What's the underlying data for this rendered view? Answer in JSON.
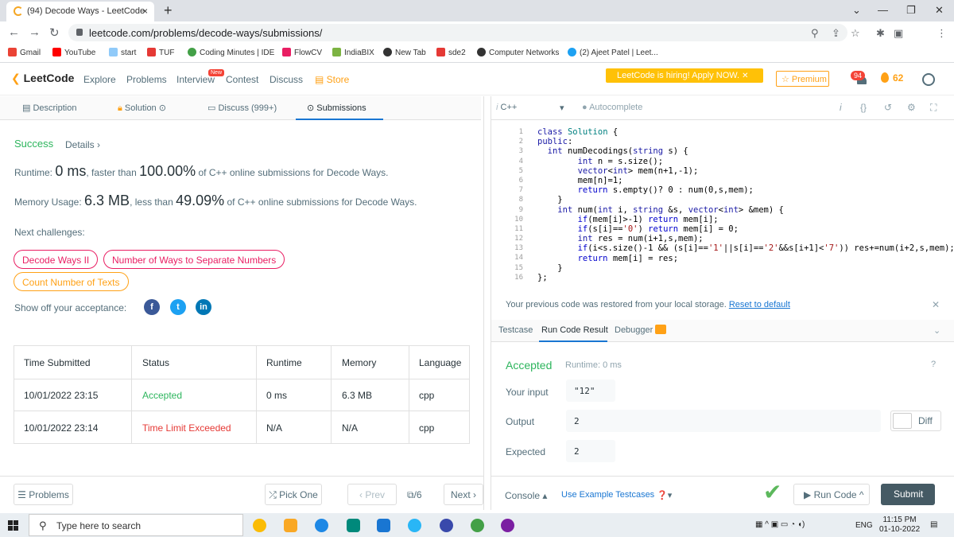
{
  "browser": {
    "tab_title": "(94) Decode Ways - LeetCode",
    "tab_close": "×",
    "new_tab": "+",
    "url": "leetcode.com/problems/decode-ways/submissions/",
    "bookmarks": [
      "Gmail",
      "YouTube",
      "start",
      "TUF",
      "Coding Minutes | IDE",
      "FlowCV",
      "IndiaBIX",
      "New Tab",
      "sde2",
      "Computer Networks",
      "(2) Ajeet Patel | Leet..."
    ]
  },
  "nav": {
    "logo": "LeetCode",
    "links": [
      "Explore",
      "Problems",
      "Interview",
      "Contest",
      "Discuss",
      "Store"
    ],
    "new_badge": "New",
    "hiring": "LeetCode is hiring! Apply NOW.",
    "premium": "☆ Premium",
    "notifications": "94",
    "streak": "62"
  },
  "left_tabs": [
    "Description",
    "Solution",
    "Discuss (999+)",
    "Submissions"
  ],
  "result": {
    "status": "Success",
    "details": "Details ›",
    "runtime_prefix": "Runtime: ",
    "runtime": "0 ms",
    "runtime_mid": ", faster than ",
    "runtime_pct": "100.00%",
    "runtime_suffix": " of C++ online submissions for Decode Ways.",
    "memory_prefix": "Memory Usage: ",
    "memory": "6.3 MB",
    "memory_mid": ", less than ",
    "memory_pct": "49.09%",
    "memory_suffix": " of C++ online submissions for Decode Ways.",
    "next_label": "Next challenges:",
    "challenges": [
      "Decode Ways II",
      "Number of Ways to Separate Numbers",
      "Count Number of Texts"
    ],
    "show_off": "Show off your acceptance:"
  },
  "table": {
    "headers": [
      "Time Submitted",
      "Status",
      "Runtime",
      "Memory",
      "Language"
    ],
    "rows": [
      [
        "10/01/2022 23:15",
        "Accepted",
        "0 ms",
        "6.3 MB",
        "cpp"
      ],
      [
        "10/01/2022 23:14",
        "Time Limit Exceeded",
        "N/A",
        "N/A",
        "cpp"
      ]
    ]
  },
  "left_bottom": {
    "problems": "☰ Problems",
    "pick_one": "⤮ Pick One",
    "prev": "‹ Prev",
    "page": "/6",
    "next": "Next ›"
  },
  "editor": {
    "language": "C++",
    "autocomplete": "● Autocomplete",
    "line_numbers": [
      "1",
      "2",
      "3",
      "4",
      "5",
      "6",
      "7",
      "8",
      "9",
      "10",
      "11",
      "12",
      "13",
      "14",
      "15",
      "16"
    ],
    "restore_msg": "Your previous code was restored from your local storage.",
    "reset": "Reset to default"
  },
  "result_panel": {
    "tabs": [
      "Testcase",
      "Run Code Result",
      "Debugger"
    ],
    "status": "Accepted",
    "runtime": "Runtime: 0 ms",
    "input_label": "Your input",
    "input": "\"12\"",
    "output_label": "Output",
    "output": "2",
    "expected_label": "Expected",
    "expected": "2",
    "diff": "Diff",
    "console": "Console ▴",
    "example": "Use Example Testcases",
    "run_code": "▶ Run Code ^",
    "submit": "Submit"
  },
  "taskbar": {
    "search": "Type here to search",
    "lang": "ENG",
    "time": "11:15 PM",
    "date": "01-10-2022"
  },
  "colors": {
    "accent_green": "#2db55d",
    "accent_orange": "#ffa116",
    "accent_red": "#e91e63",
    "error_red": "#e53935",
    "link_blue": "#1976d2"
  }
}
